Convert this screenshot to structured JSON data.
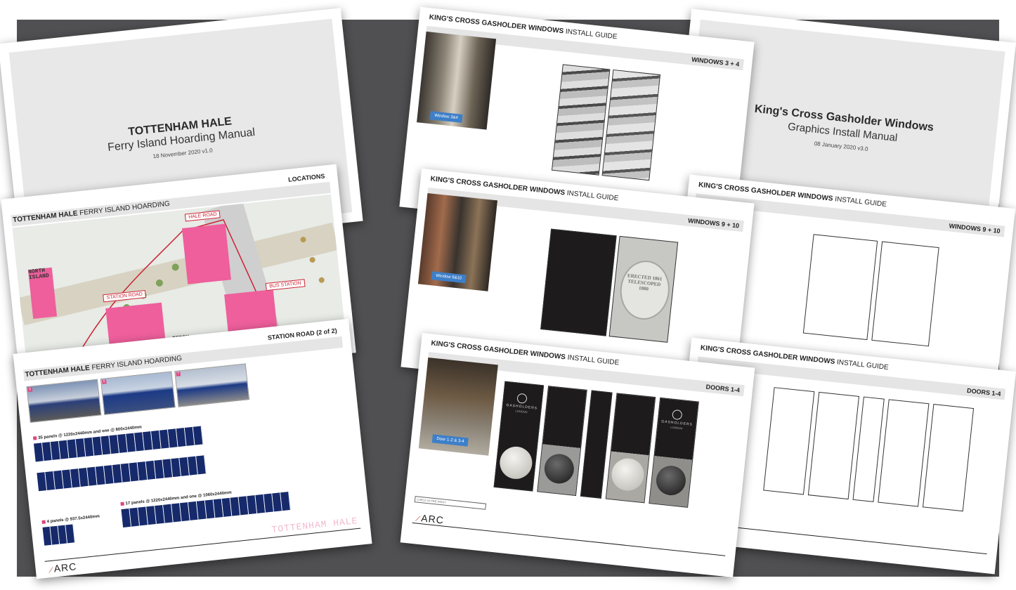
{
  "colors": {
    "backdrop": "#505052",
    "accent_pink": "#ee5f9c",
    "road_red": "#cc2233",
    "hoarding_blue": "#162a6b",
    "label_blue": "#3d7fc8"
  },
  "tottenham_cover": {
    "title": "TOTTENHAM HALE",
    "subtitle": "Ferry Island Hoarding Manual",
    "date": "18 November 2020 v1.0"
  },
  "tottenham_locations": {
    "header_bold": "TOTTENHAM HALE",
    "header_rest": " FERRY ISLAND HOARDING",
    "section": "LOCATIONS",
    "roads": [
      "HALE ROAD",
      "STATION ROAD",
      "BUS STATION"
    ],
    "island_north": "NORTH ISLAND",
    "island_ferry": "FERRY ISLAND"
  },
  "tottenham_station": {
    "header_bold": "TOTTENHAM HALE",
    "header_rest": " FERRY ISLAND HOARDING",
    "section": "STATION ROAD (2 of 2)",
    "thumbs": [
      "5",
      "6",
      "7"
    ],
    "panel_notes": [
      "35 panels @ 1220x2440mm and one @ 800x2440mm",
      "4 panels @ 937.5x2440mm",
      "17 panels @ 1220x2440mm and one @ 1060x2440mm"
    ],
    "ghost": "TOTTENHAM HALE",
    "logo": "ARC"
  },
  "kx_windows34": {
    "header_bold": "KING'S CROSS GASHOLDER WINDOWS",
    "header_rest": " INSTALL GUIDE",
    "section": "WINDOWS 3 + 4",
    "photo_label": "Window 3&4"
  },
  "kx_cover": {
    "title": "King's Cross Gasholder Windows",
    "subtitle": "Graphics Install Manual",
    "date": "08 January 2020 v3.0"
  },
  "kx_windows910": {
    "header_bold": "KING'S CROSS GASHOLDER WINDOWS",
    "header_rest": " INSTALL GUIDE",
    "section": "WINDOWS 9 + 10",
    "photo_label": "Window 9&10",
    "plaque": "ERECTED 1861 TELESCOPED 1880"
  },
  "kx_windows910_blank": {
    "header_bold": "KING'S CROSS GASHOLDER WINDOWS",
    "header_rest": " INSTALL GUIDE",
    "section": "WINDOWS 9 + 10"
  },
  "kx_doors": {
    "header_bold": "KING'S CROSS GASHOLDER WINDOWS",
    "header_rest": " INSTALL GUIDE",
    "section": "DOORS 1-4",
    "photo_label": "Door 1-2 & 3-4",
    "brand": "GASHOLDERS",
    "brand_sub": "LONDON",
    "box": "CHECK IN PRE-PRINT",
    "logo": "ARC"
  },
  "kx_doors_blank": {
    "header_bold": "KING'S CROSS GASHOLDER WINDOWS",
    "header_rest": " INSTALL GUIDE",
    "section": "DOORS 1-4"
  }
}
